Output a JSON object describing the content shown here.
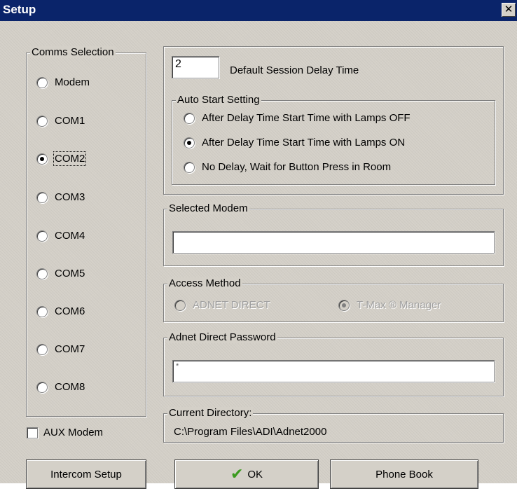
{
  "window": {
    "title": "Setup",
    "close_glyph": "✕"
  },
  "comms": {
    "legend": "Comms Selection",
    "items": [
      {
        "label": "Modem",
        "checked": false
      },
      {
        "label": "COM1",
        "checked": false
      },
      {
        "label": "COM2",
        "checked": true
      },
      {
        "label": "COM3",
        "checked": false
      },
      {
        "label": "COM4",
        "checked": false
      },
      {
        "label": "COM5",
        "checked": false
      },
      {
        "label": "COM6",
        "checked": false
      },
      {
        "label": "COM7",
        "checked": false
      },
      {
        "label": "COM8",
        "checked": false
      }
    ]
  },
  "aux_modem": {
    "label": "AUX Modem",
    "checked": false
  },
  "session": {
    "delay_value": "2",
    "delay_label": "Default Session Delay Time",
    "auto_start": {
      "legend": "Auto Start Setting",
      "options": [
        {
          "label": "After Delay Time Start Time with Lamps OFF",
          "checked": false
        },
        {
          "label": "After Delay Time Start Time with Lamps ON",
          "checked": true
        },
        {
          "label": "No Delay, Wait for Button Press in Room",
          "checked": false
        }
      ]
    }
  },
  "selected_modem": {
    "legend": "Selected Modem",
    "value": ""
  },
  "access_method": {
    "legend": "Access Method",
    "options": [
      {
        "label": "ADNET DIRECT",
        "checked": false,
        "disabled": true
      },
      {
        "label": "T-Max ® Manager",
        "checked": true,
        "disabled": true
      }
    ]
  },
  "password": {
    "legend": "Adnet Direct Password",
    "value": "*"
  },
  "current_directory": {
    "legend": "Current Directory:",
    "value": "C:\\Program Files\\ADI\\Adnet2000"
  },
  "buttons": {
    "intercom": "Intercom Setup",
    "ok": "OK",
    "ok_icon": "✔",
    "phone_book": "Phone Book"
  }
}
